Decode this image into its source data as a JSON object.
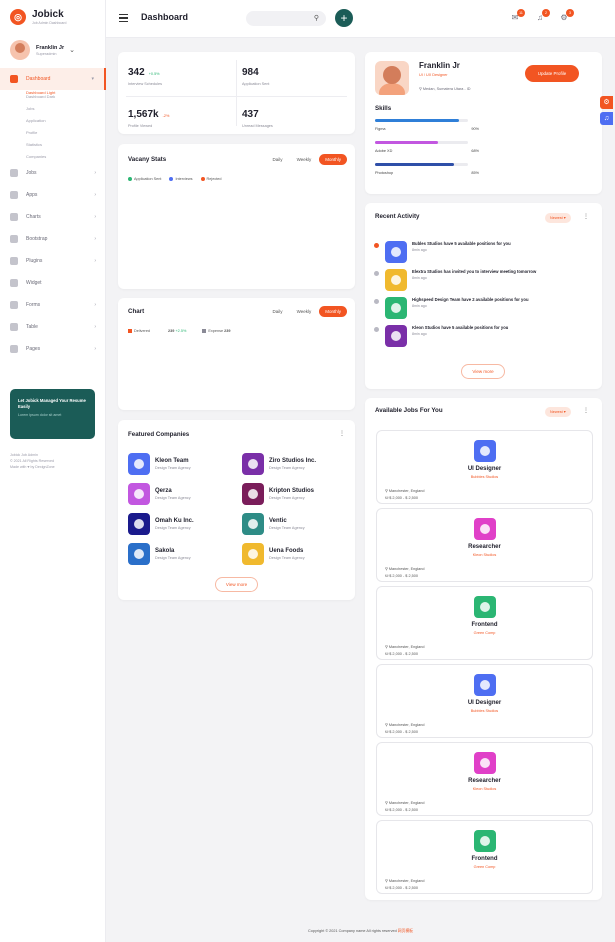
{
  "brand": {
    "name": "Jobick",
    "tagline": "Job Admin Dashboard"
  },
  "user": {
    "name": "Franklin Jr",
    "role": "Superadmin"
  },
  "nav": {
    "dashboard": "Dashboard",
    "sub": [
      "Dashboard Light",
      "Dashboard Dark",
      "Jobs",
      "Application",
      "Profile",
      "Statistics",
      "Companies"
    ],
    "items": [
      "Jobs",
      "Apps",
      "Charts",
      "Bootstrap",
      "Plugins",
      "Widget",
      "Forms",
      "Table",
      "Pages"
    ]
  },
  "promo": {
    "title": "Let Jobick Managed Your Resume Easily",
    "sub": "Lorem ipsum dolor sit amet"
  },
  "sidebar_footer": {
    "line1": "Jobick Job Admin",
    "line2": "© 2021 All Rights Reserved",
    "line3": "Made with ♥ by DexignZone"
  },
  "header": {
    "title": "Dashboard",
    "notif_counts": [
      "11",
      "2",
      "3"
    ]
  },
  "stats": [
    {
      "value": "342",
      "change": "+0.5%",
      "label": "Interview Schedules",
      "change_color": "#2bb673"
    },
    {
      "value": "984",
      "change": "",
      "label": "Application Sent",
      "change_color": "#2bb673"
    },
    {
      "value": "1,567k",
      "change": "-2%",
      "label": "Profile Viewed",
      "change_color": "#f25522"
    },
    {
      "value": "437",
      "change": "",
      "label": "Unread Messages",
      "change_color": "#2bb673"
    }
  ],
  "vacancy": {
    "title": "Vacany Stats",
    "tabs": [
      "Daily",
      "Weekly",
      "Monthly"
    ],
    "legend": [
      "Application Sent",
      "Interviews",
      "Rejected"
    ],
    "legend_colors": [
      "#2bb673",
      "#4e6ef2",
      "#f25522"
    ]
  },
  "chart": {
    "title": "Chart",
    "tabs": [
      "Daily",
      "Weekly",
      "Monthly"
    ],
    "delivered_label": "Delivered",
    "delivered_value": "239",
    "delivered_change": "+2.5%",
    "expense_label": "Expense",
    "expense_value": "239"
  },
  "companies": {
    "title": "Featured Companies",
    "view_more": "View more",
    "items": [
      {
        "name": "Kleon Team",
        "sub": "Design Team Agency",
        "color": "#4e6ef2"
      },
      {
        "name": "Ziro Studios Inc.",
        "sub": "Design Team Agency",
        "color": "#7a2fa8"
      },
      {
        "name": "Qerza",
        "sub": "Design Team Agency",
        "color": "#c257e0"
      },
      {
        "name": "Kripton Studios",
        "sub": "Design Team Agency",
        "color": "#7a1d5a"
      },
      {
        "name": "Omah Ku Inc.",
        "sub": "Design Team Agency",
        "color": "#1a1a8c"
      },
      {
        "name": "Ventic",
        "sub": "Design Team Agency",
        "color": "#2e8c86"
      },
      {
        "name": "Sakola",
        "sub": "Design Team Agency",
        "color": "#2a6fc9"
      },
      {
        "name": "Uena Foods",
        "sub": "Design Team Agency",
        "color": "#f0b92e"
      }
    ]
  },
  "profile": {
    "name": "Franklin Jr",
    "role": "UI / UX Designer",
    "location": "Medan, Sumatera Utara - ID",
    "button": "Update Profile",
    "skills_title": "Skills",
    "skills": [
      {
        "name": "Figma",
        "pct": "90%",
        "value": 90,
        "color": "#2f7fd8"
      },
      {
        "name": "Adobe XD",
        "pct": "68%",
        "value": 68,
        "color": "#c257e0"
      },
      {
        "name": "Photoshop",
        "pct": "85%",
        "value": 85,
        "color": "#2f4fa8"
      }
    ]
  },
  "activity": {
    "title": "Recent Activity",
    "filter": "Newest",
    "view_more": "View more",
    "items": [
      {
        "title": "Bubles Studios have 5 available positions for you",
        "time": "8min ago",
        "color": "#4e6ef2",
        "dot": "#f25522"
      },
      {
        "title": "Elextra Studios has invited you to interview meeting tomorrow",
        "time": "8min ago",
        "color": "#f0b92e",
        "dot": "#b9b9c3"
      },
      {
        "title": "Highspeed Design Team have 2 available positions for you",
        "time": "8min ago",
        "color": "#2bb673",
        "dot": "#b9b9c3"
      },
      {
        "title": "Kleon Studios have 5 available positions for you",
        "time": "8min ago",
        "color": "#7a2fa8",
        "dot": "#b9b9c3"
      }
    ]
  },
  "jobs": {
    "title": "Available Jobs For You",
    "filter": "Newest",
    "items": [
      {
        "title": "UI Designer",
        "company": "Bubbles Studios",
        "location": "Manchester, England",
        "salary": "$ 2,000 - $ 2,500",
        "color": "#4e6ef2"
      },
      {
        "title": "Researcher",
        "company": "Kleon Studios",
        "location": "Manchester, England",
        "salary": "$ 2,000 - $ 2,500",
        "color": "#e040c8"
      },
      {
        "title": "Frontend",
        "company": "Green Comp",
        "location": "Manchester, England",
        "salary": "$ 2,000 - $ 2,500",
        "color": "#2bb673"
      },
      {
        "title": "UI Designer",
        "company": "Bubbles Studios",
        "location": "Manchester, England",
        "salary": "$ 2,000 - $ 2,500",
        "color": "#4e6ef2"
      },
      {
        "title": "Researcher",
        "company": "Kleon Studios",
        "location": "Manchester, England",
        "salary": "$ 2,000 - $ 2,500",
        "color": "#e040c8"
      },
      {
        "title": "Frontend",
        "company": "Green Comp",
        "location": "Manchester, England",
        "salary": "$ 2,000 - $ 2,500",
        "color": "#2bb673"
      }
    ]
  },
  "footer": {
    "text": "Copyright © 2021 Company name All rights reserved",
    "link": "网页模板"
  }
}
